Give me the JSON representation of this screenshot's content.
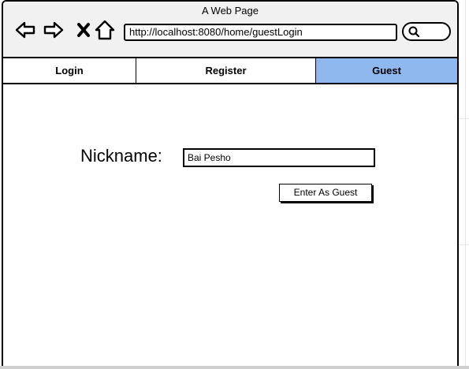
{
  "window": {
    "title": "A Web Page"
  },
  "toolbar": {
    "icons": [
      "back-arrow-icon",
      "forward-arrow-icon",
      "close-x-icon",
      "home-icon",
      "search-icon"
    ],
    "url": "http://localhost:8080/home/guestLogin"
  },
  "tabs": [
    {
      "label": "Login",
      "active": false
    },
    {
      "label": "Register",
      "active": false
    },
    {
      "label": "Guest",
      "active": true
    }
  ],
  "form": {
    "nickname_label": "Nickname:",
    "nickname_value": "Bai Pesho",
    "submit_label": "Enter As Guest"
  },
  "colors": {
    "active_tab": "#8fb8ef",
    "titlebar": "#f1f1f1",
    "border": "#000000"
  }
}
